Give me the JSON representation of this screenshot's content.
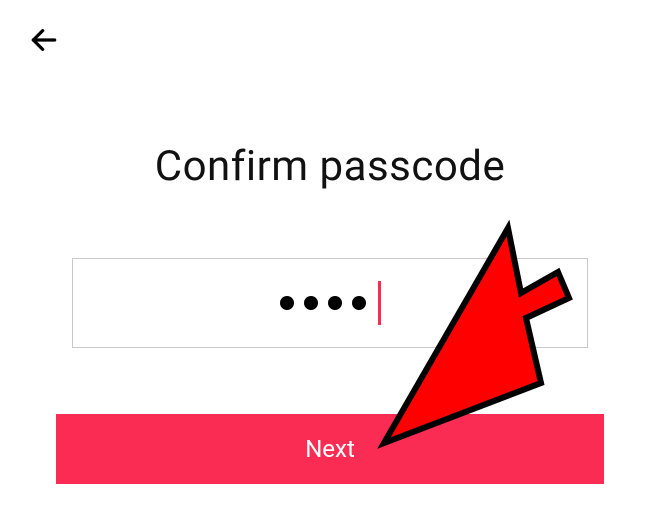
{
  "colors": {
    "accent": "#fb2c53",
    "border": "#c9c9c9",
    "title": "#111111",
    "button_text": "#ffffff",
    "annotation": "#ff0000"
  },
  "header": {
    "back_icon": "arrow-left-icon"
  },
  "title": "Confirm passcode",
  "passcode": {
    "masked_value": "••••",
    "length": 4,
    "cursor_visible": true
  },
  "buttons": {
    "next_label": "Next"
  },
  "annotation": {
    "type": "pointer-arrow",
    "target": "next-button"
  }
}
